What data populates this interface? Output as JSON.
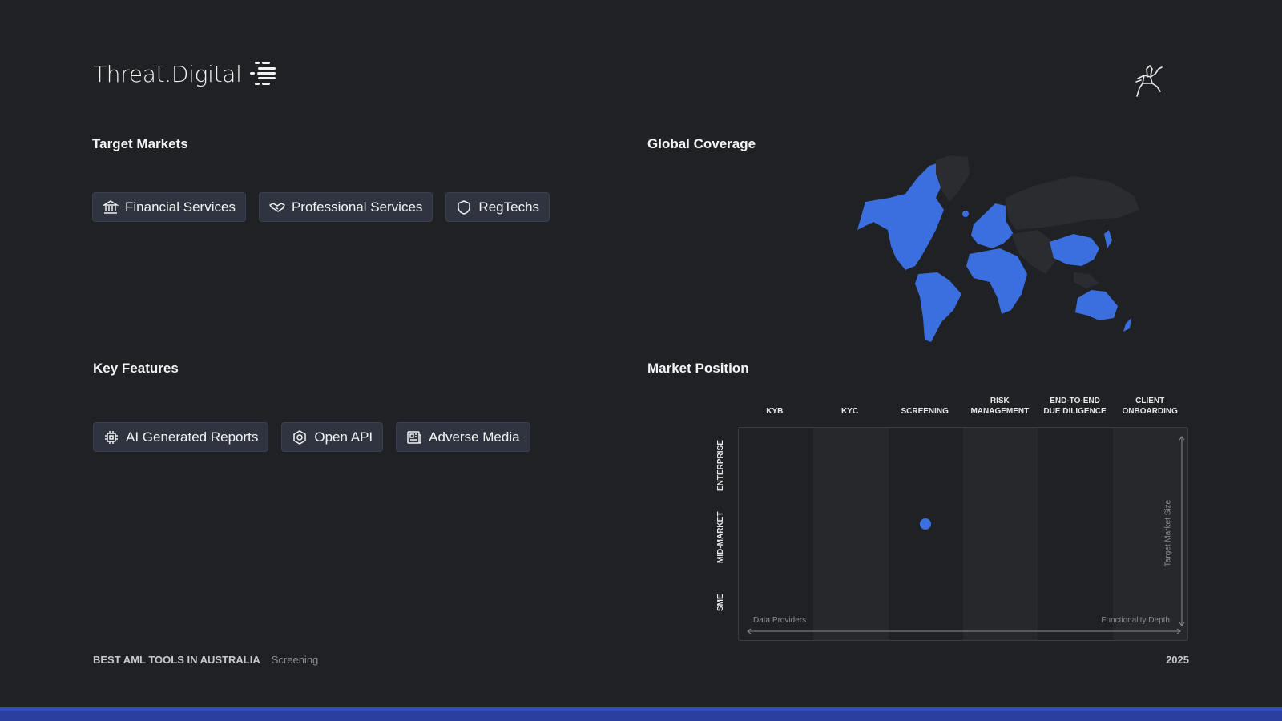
{
  "brand": {
    "name": "Threat.Digital"
  },
  "target_markets": {
    "title": "Target Markets",
    "items": [
      {
        "label": "Financial Services",
        "icon": "bank-icon"
      },
      {
        "label": "Professional Services",
        "icon": "handshake-icon"
      },
      {
        "label": "RegTechs",
        "icon": "shield-icon"
      }
    ]
  },
  "global_coverage": {
    "title": "Global Coverage",
    "highlight_color": "#3b6fe0",
    "base_color": "#2b2c30"
  },
  "key_features": {
    "title": "Key Features",
    "items": [
      {
        "label": "AI Generated Reports",
        "icon": "chip-icon"
      },
      {
        "label": "Open API",
        "icon": "hexagon-icon"
      },
      {
        "label": "Adverse Media",
        "icon": "newspaper-icon"
      }
    ]
  },
  "market_position": {
    "title": "Market Position",
    "columns": [
      "KYB",
      "KYC",
      "SCREENING",
      "RISK\nMANAGEMENT",
      "END-TO-END\nDUE DILIGENCE",
      "CLIENT\nONBOARDING"
    ],
    "rows": [
      "ENTERPRISE",
      "MID-MARKET",
      "SME"
    ],
    "x_axis_left": "Data Providers",
    "x_axis_right": "Functionality Depth",
    "y_axis": "Target Market Size",
    "position": {
      "column": "SCREENING",
      "row": "MID-MARKET"
    },
    "dot_color": "#3b6fe0"
  },
  "footer": {
    "title": "BEST AML TOOLS IN AUSTRALIA",
    "category": "Screening",
    "year": "2025"
  }
}
